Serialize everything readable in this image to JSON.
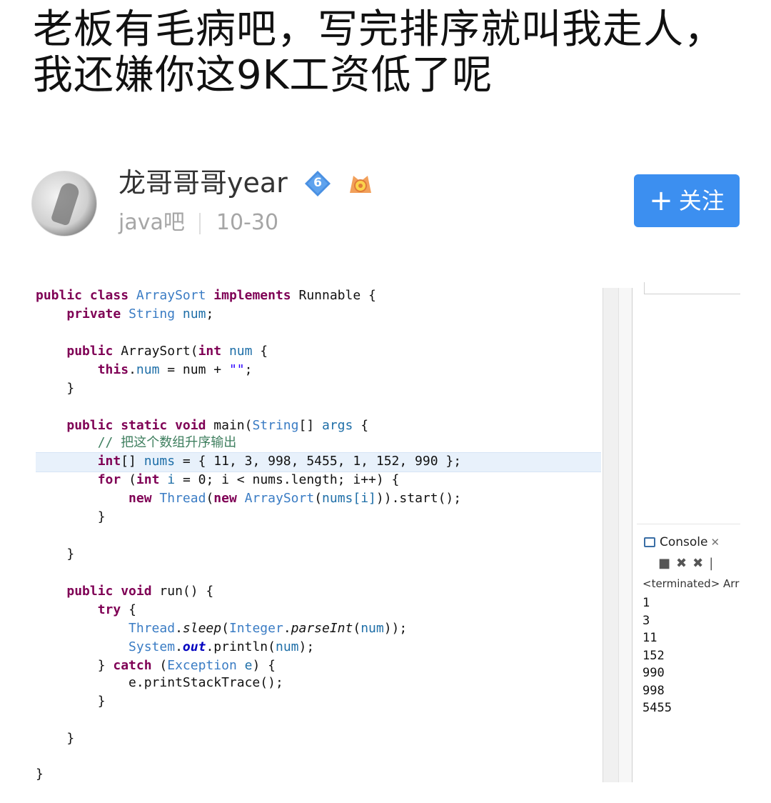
{
  "post": {
    "title": "老板有毛病吧，写完排序就叫我走人，我还嫌你这9K工资低了呢",
    "author": "龙哥哥哥year",
    "level": "6",
    "forum": "java吧",
    "date": "10-30",
    "follow_label": "关注",
    "follow_plus": "+",
    "colors": {
      "follow": "#3c8ff0",
      "meta": "#a6a6a6",
      "badge": "#4a90e2"
    }
  },
  "code": {
    "lines": [
      [
        [
          "k",
          "public class "
        ],
        [
          "t",
          "ArraySort "
        ],
        [
          "k",
          "implements "
        ],
        [
          "",
          "Runnable {"
        ]
      ],
      [
        [
          "",
          "    "
        ],
        [
          "k",
          "private "
        ],
        [
          "t",
          "String "
        ],
        [
          "f",
          "num"
        ],
        [
          "",
          ";"
        ]
      ],
      [],
      [
        [
          "",
          "    "
        ],
        [
          "k",
          "public "
        ],
        [
          "",
          "ArraySort("
        ],
        [
          "k",
          "int "
        ],
        [
          "f",
          "num"
        ],
        [
          "",
          " {"
        ]
      ],
      [
        [
          "",
          "        "
        ],
        [
          "k",
          "this"
        ],
        [
          "",
          "."
        ],
        [
          "f",
          "num"
        ],
        [
          "",
          " = num + "
        ],
        [
          "s",
          "\"\""
        ],
        [
          "",
          ";"
        ]
      ],
      [
        [
          "",
          "    }"
        ]
      ],
      [],
      [
        [
          "",
          "    "
        ],
        [
          "k",
          "public static void "
        ],
        [
          "",
          "main("
        ],
        [
          "t",
          "String"
        ],
        [
          "",
          "[] "
        ],
        [
          "f",
          "args"
        ],
        [
          "",
          " {"
        ]
      ],
      [
        [
          "",
          "        "
        ],
        [
          "c",
          "// 把这个数组升序输出"
        ]
      ],
      [
        [
          "",
          "        "
        ],
        [
          "k",
          "int"
        ],
        [
          "",
          "[] "
        ],
        [
          "f",
          "nums"
        ],
        [
          "",
          " = { 11, 3, 998, 5455, 1, 152, 990 };"
        ]
      ],
      [
        [
          "",
          "        "
        ],
        [
          "k",
          "for "
        ],
        [
          "",
          "("
        ],
        [
          "k",
          "int "
        ],
        [
          "f",
          "i"
        ],
        [
          "",
          " = 0; i < nums.length; i++) {"
        ]
      ],
      [
        [
          "",
          "            "
        ],
        [
          "k",
          "new "
        ],
        [
          "t",
          "Thread"
        ],
        [
          "",
          "("
        ],
        [
          "k",
          "new "
        ],
        [
          "t",
          "ArraySort"
        ],
        [
          "",
          "("
        ],
        [
          "f",
          "nums[i]"
        ],
        [
          "",
          ")).start();"
        ]
      ],
      [
        [
          "",
          "        }"
        ]
      ],
      [],
      [
        [
          "",
          "    }"
        ]
      ],
      [],
      [
        [
          "",
          "    "
        ],
        [
          "k",
          "public void "
        ],
        [
          "",
          "run() {"
        ]
      ],
      [
        [
          "",
          "        "
        ],
        [
          "k",
          "try "
        ],
        [
          "",
          "{"
        ]
      ],
      [
        [
          "",
          "            "
        ],
        [
          "t",
          "Thread"
        ],
        [
          "",
          "."
        ],
        [
          "it",
          "sleep"
        ],
        [
          "",
          "("
        ],
        [
          "t",
          "Integer"
        ],
        [
          "",
          "."
        ],
        [
          "it",
          "parseInt"
        ],
        [
          "",
          "("
        ],
        [
          "f",
          "num"
        ],
        [
          "",
          "));"
        ]
      ],
      [
        [
          "",
          "            "
        ],
        [
          "t",
          "System"
        ],
        [
          "",
          "."
        ],
        [
          "sf",
          "out"
        ],
        [
          "",
          ".println("
        ],
        [
          "f",
          "num"
        ],
        [
          "",
          ");"
        ]
      ],
      [
        [
          "",
          "        } "
        ],
        [
          "k",
          "catch "
        ],
        [
          "",
          "("
        ],
        [
          "t",
          "Exception "
        ],
        [
          "f",
          "e"
        ],
        [
          "",
          ") {"
        ]
      ],
      [
        [
          "",
          "            e.printStackTrace();"
        ]
      ],
      [
        [
          "",
          "        }"
        ]
      ],
      [],
      [
        [
          "",
          "    }"
        ]
      ],
      [],
      [
        [
          "",
          "}"
        ]
      ]
    ]
  },
  "console": {
    "tab_label": "Console",
    "terminated": "<terminated> Arr",
    "output": [
      "1",
      "3",
      "11",
      "152",
      "990",
      "998",
      "5455"
    ]
  }
}
